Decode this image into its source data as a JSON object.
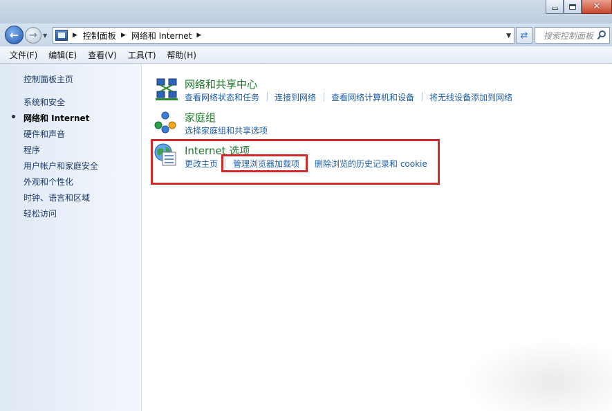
{
  "window": {
    "minimize_glyph": "",
    "maximize_glyph": "",
    "close_glyph": "✕"
  },
  "nav": {
    "back_icon": "back-arrow-icon",
    "forward_icon": "forward-arrow-icon",
    "breadcrumbs": [
      "控制面板",
      "网络和 Internet"
    ],
    "search_placeholder": "搜索控制面板"
  },
  "menu": [
    "文件(F)",
    "编辑(E)",
    "查看(V)",
    "工具(T)",
    "帮助(H)"
  ],
  "sidebar": {
    "home": "控制面板主页",
    "items": [
      {
        "label": "系统和安全",
        "active": false
      },
      {
        "label": "网络和 Internet",
        "active": true
      },
      {
        "label": "硬件和声音",
        "active": false
      },
      {
        "label": "程序",
        "active": false
      },
      {
        "label": "用户帐户和家庭安全",
        "active": false
      },
      {
        "label": "外观和个性化",
        "active": false
      },
      {
        "label": "时钟、语言和区域",
        "active": false
      },
      {
        "label": "轻松访问",
        "active": false
      }
    ]
  },
  "categories": [
    {
      "icon": "network-sharing-center-icon",
      "title": "网络和共享中心",
      "links": [
        "查看网络状态和任务",
        "连接到网络",
        "查看网络计算机和设备",
        "将无线设备添加到网络"
      ]
    },
    {
      "icon": "homegroup-icon",
      "title": "家庭组",
      "links": [
        "选择家庭组和共享选项"
      ]
    },
    {
      "icon": "internet-options-icon",
      "title": "Internet 选项",
      "links": [
        "更改主页",
        "管理浏览器加载项",
        "删除浏览的历史记录和 cookie"
      ]
    }
  ],
  "highlight_color": "#d22a2a"
}
